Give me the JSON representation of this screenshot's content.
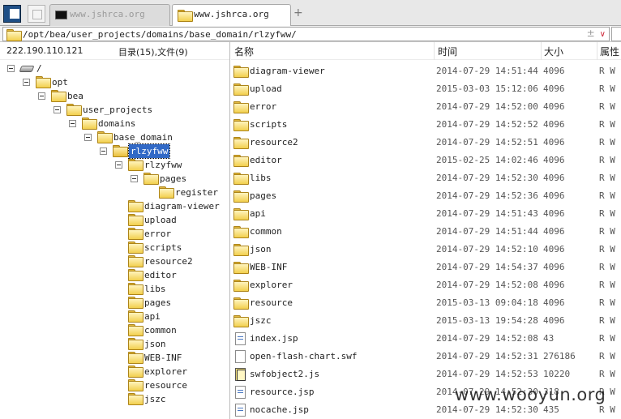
{
  "tabs": [
    {
      "label": "www.jshrca.org",
      "active": false
    },
    {
      "label": "www.jshrca.org",
      "active": true
    }
  ],
  "address": {
    "path": "/opt/bea/user_projects/domains/base_domain/rlzyfww/",
    "history_glyph": "±",
    "dropdown_glyph": "∨"
  },
  "left_panel": {
    "ip": "222.190.110.121",
    "counts": "目录(15),文件(9)"
  },
  "tree": [
    {
      "label": "/",
      "icon": "drive-icon",
      "depth": 0,
      "expandable": true
    },
    {
      "label": "opt",
      "icon": "folder-icon",
      "depth": 1,
      "expandable": true
    },
    {
      "label": "bea",
      "icon": "folder-icon",
      "depth": 2,
      "expandable": true
    },
    {
      "label": "user_projects",
      "icon": "folder-icon",
      "depth": 3,
      "expandable": true
    },
    {
      "label": "domains",
      "icon": "folder-icon",
      "depth": 4,
      "expandable": true
    },
    {
      "label": "base_domain",
      "icon": "folder-icon",
      "depth": 5,
      "expandable": true
    },
    {
      "label": "rlzyfww",
      "icon": "folder-open-icon",
      "depth": 6,
      "expandable": true,
      "selected": true
    },
    {
      "label": "rlzyfww",
      "icon": "folder-icon",
      "depth": 7,
      "expandable": true
    },
    {
      "label": "pages",
      "icon": "folder-icon",
      "depth": 8,
      "expandable": true
    },
    {
      "label": "register",
      "icon": "folder-icon",
      "depth": 9,
      "expandable": false
    },
    {
      "label": "diagram-viewer",
      "icon": "folder-icon",
      "depth": 7,
      "expandable": false
    },
    {
      "label": "upload",
      "icon": "folder-icon",
      "depth": 7,
      "expandable": false
    },
    {
      "label": "error",
      "icon": "folder-icon",
      "depth": 7,
      "expandable": false
    },
    {
      "label": "scripts",
      "icon": "folder-icon",
      "depth": 7,
      "expandable": false
    },
    {
      "label": "resource2",
      "icon": "folder-icon",
      "depth": 7,
      "expandable": false
    },
    {
      "label": "editor",
      "icon": "folder-icon",
      "depth": 7,
      "expandable": false
    },
    {
      "label": "libs",
      "icon": "folder-icon",
      "depth": 7,
      "expandable": false
    },
    {
      "label": "pages",
      "icon": "folder-icon",
      "depth": 7,
      "expandable": false
    },
    {
      "label": "api",
      "icon": "folder-icon",
      "depth": 7,
      "expandable": false
    },
    {
      "label": "common",
      "icon": "folder-icon",
      "depth": 7,
      "expandable": false
    },
    {
      "label": "json",
      "icon": "folder-icon",
      "depth": 7,
      "expandable": false
    },
    {
      "label": "WEB-INF",
      "icon": "folder-icon",
      "depth": 7,
      "expandable": false
    },
    {
      "label": "explorer",
      "icon": "folder-icon",
      "depth": 7,
      "expandable": false
    },
    {
      "label": "resource",
      "icon": "folder-icon",
      "depth": 7,
      "expandable": false
    },
    {
      "label": "jszc",
      "icon": "folder-icon",
      "depth": 7,
      "expandable": false
    }
  ],
  "columns": {
    "name": "名称",
    "time": "时间",
    "size": "大小",
    "attr": "属性"
  },
  "files": [
    {
      "name": "diagram-viewer",
      "time": "2014-07-29 14:51:44",
      "size": "4096",
      "attr": "R W",
      "type": "folder"
    },
    {
      "name": "upload",
      "time": "2015-03-03 15:12:06",
      "size": "4096",
      "attr": "R W",
      "type": "folder"
    },
    {
      "name": "error",
      "time": "2014-07-29 14:52:00",
      "size": "4096",
      "attr": "R W",
      "type": "folder"
    },
    {
      "name": "scripts",
      "time": "2014-07-29 14:52:52",
      "size": "4096",
      "attr": "R W",
      "type": "folder"
    },
    {
      "name": "resource2",
      "time": "2014-07-29 14:52:51",
      "size": "4096",
      "attr": "R W",
      "type": "folder"
    },
    {
      "name": "editor",
      "time": "2015-02-25 14:02:46",
      "size": "4096",
      "attr": "R W",
      "type": "folder"
    },
    {
      "name": "libs",
      "time": "2014-07-29 14:52:30",
      "size": "4096",
      "attr": "R W",
      "type": "folder"
    },
    {
      "name": "pages",
      "time": "2014-07-29 14:52:36",
      "size": "4096",
      "attr": "R W",
      "type": "folder"
    },
    {
      "name": "api",
      "time": "2014-07-29 14:51:43",
      "size": "4096",
      "attr": "R W",
      "type": "folder"
    },
    {
      "name": "common",
      "time": "2014-07-29 14:51:44",
      "size": "4096",
      "attr": "R W",
      "type": "folder"
    },
    {
      "name": "json",
      "time": "2014-07-29 14:52:10",
      "size": "4096",
      "attr": "R W",
      "type": "folder"
    },
    {
      "name": "WEB-INF",
      "time": "2014-07-29 14:54:37",
      "size": "4096",
      "attr": "R W",
      "type": "folder"
    },
    {
      "name": "explorer",
      "time": "2014-07-29 14:52:08",
      "size": "4096",
      "attr": "R W",
      "type": "folder"
    },
    {
      "name": "resource",
      "time": "2015-03-13 09:04:18",
      "size": "4096",
      "attr": "R W",
      "type": "folder"
    },
    {
      "name": "jszc",
      "time": "2015-03-13 19:54:28",
      "size": "4096",
      "attr": "R W",
      "type": "folder"
    },
    {
      "name": "index.jsp",
      "time": "2014-07-29 14:52:08",
      "size": "43",
      "attr": "R W",
      "type": "jsp"
    },
    {
      "name": "open-flash-chart.swf",
      "time": "2014-07-29 14:52:31",
      "size": "276186",
      "attr": "R W",
      "type": "swf"
    },
    {
      "name": "swfobject2.js",
      "time": "2014-07-29 14:52:53",
      "size": "10220",
      "attr": "R W",
      "type": "js"
    },
    {
      "name": "resource.jsp",
      "time": "2014-07-29 14:52:30",
      "size": "318",
      "attr": "R W",
      "type": "jsp"
    },
    {
      "name": "nocache.jsp",
      "time": "2014-07-29 14:52:30",
      "size": "435",
      "attr": "R W",
      "type": "jsp"
    }
  ],
  "watermark": "www.wooyun.org"
}
